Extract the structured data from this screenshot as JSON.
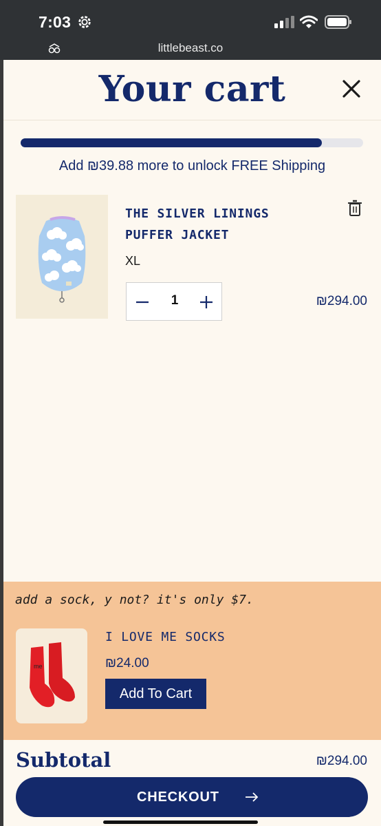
{
  "status_bar": {
    "time": "7:03",
    "url": "littlebeast.co"
  },
  "cart": {
    "title": "Your cart",
    "shipping_progress": 0.88,
    "shipping_message": "Add ₪39.88 more to unlock FREE Shipping",
    "items": [
      {
        "name_line1": "THE SILVER LININGS",
        "name_line2": "PUFFER JACKET",
        "variant": "XL",
        "quantity": "1",
        "price": "₪294.00"
      }
    ]
  },
  "upsell": {
    "message": "add a sock, y not? it's only $7.",
    "product_name": "I LOVE ME SOCKS",
    "price": "₪24.00",
    "button_label": "Add To Cart"
  },
  "footer": {
    "subtotal_label": "Subtotal",
    "subtotal_value": "₪294.00",
    "checkout_label": "CHECKOUT"
  },
  "colors": {
    "brand_navy": "#14296b",
    "drawer_bg": "#fdf8f0",
    "upsell_bg": "#f5c497"
  }
}
